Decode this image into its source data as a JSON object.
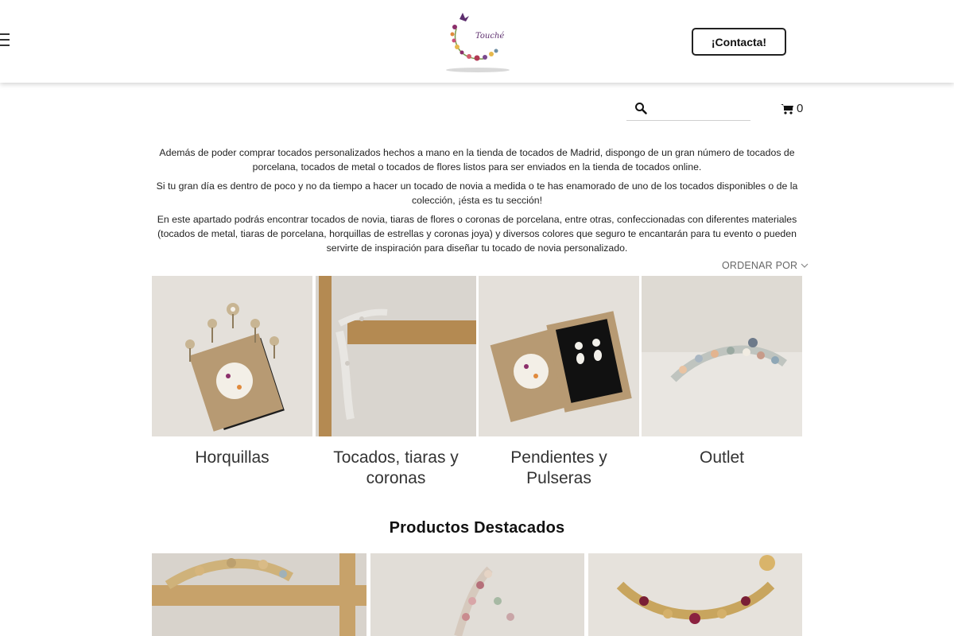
{
  "header": {
    "logo_text": "Touché",
    "contact_label": "¡Contacta!"
  },
  "search": {
    "placeholder": "",
    "value": ""
  },
  "cart": {
    "count": "0"
  },
  "intro": {
    "p1": "Además de poder comprar tocados personalizados hechos a mano en la tienda de tocados de Madrid, dispongo de un gran número de tocados de porcelana, tocados de metal o tocados de flores listos para ser enviados en la tienda de tocados online.",
    "p2": "Si tu gran día es dentro de poco y no da tiempo a hacer un tocado de novia a medida o te has enamorado de uno de los tocados disponibles o de la colección, ¡ésta es tu sección!",
    "p3": "En este apartado podrás encontrar tocados de novia, tiaras de flores o coronas de porcelana, entre otras, confeccionadas con diferentes materiales (tocados de metal, tiaras de porcelana, horquillas de estrellas y coronas joya) y diversos colores que seguro te encantarán para tu evento o pueden servirte de inspiración para diseñar tu tocado de novia personalizado."
  },
  "order_by": {
    "label": "ORDENAR POR"
  },
  "categories": [
    {
      "label": "Horquillas"
    },
    {
      "label": "Tocados, tiaras y coronas"
    },
    {
      "label": "Pendientes y Pulseras"
    },
    {
      "label": "Outlet"
    }
  ],
  "featured": {
    "title": "Productos Destacados"
  },
  "icons": {
    "menu": "hamburger-menu-icon",
    "search": "search-icon",
    "cart": "shopping-cart-icon",
    "chevron": "chevron-down-icon"
  },
  "colors": {
    "text": "#222222",
    "muted": "#666666",
    "button_border": "#222222",
    "photo_background": "#e6e2dc"
  }
}
